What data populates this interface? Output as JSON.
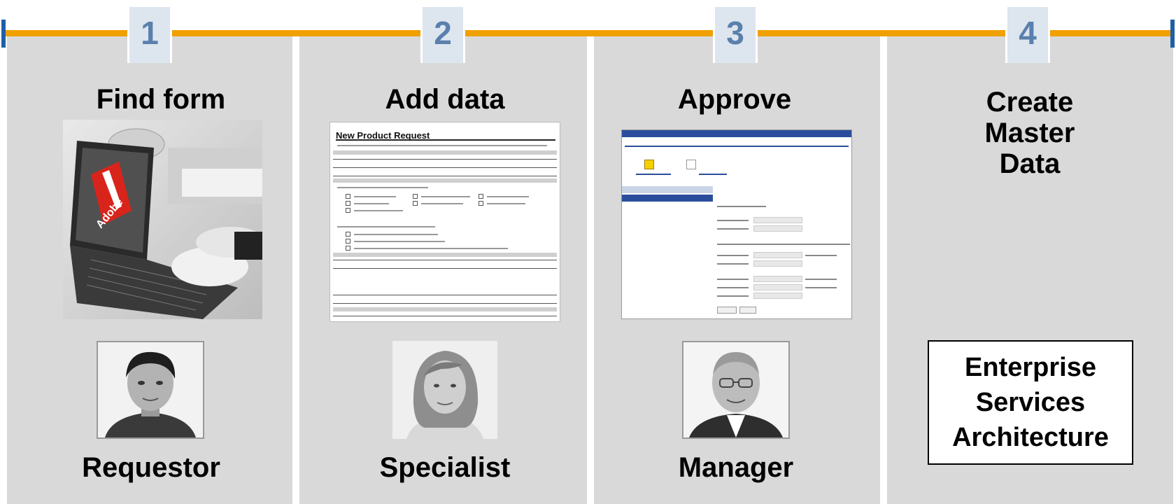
{
  "steps": [
    {
      "number": "1",
      "title": "Find form",
      "role": "Requestor",
      "logo_text": "Adobe"
    },
    {
      "number": "2",
      "title": "Add data",
      "role": "Specialist",
      "form_title": "New Product Request"
    },
    {
      "number": "3",
      "title": "Approve",
      "role": "Manager"
    },
    {
      "number": "4",
      "title_lines": [
        "Create",
        "Master",
        "Data"
      ]
    }
  ],
  "architecture_box": {
    "lines": [
      "Enterprise",
      "Services",
      "Architecture"
    ]
  },
  "colors": {
    "timeline": "#f0a000",
    "tick": "#1f5fa8",
    "column": "#d9d9d9",
    "number_box": "#dde5ee",
    "number_text": "#5a80ad"
  }
}
